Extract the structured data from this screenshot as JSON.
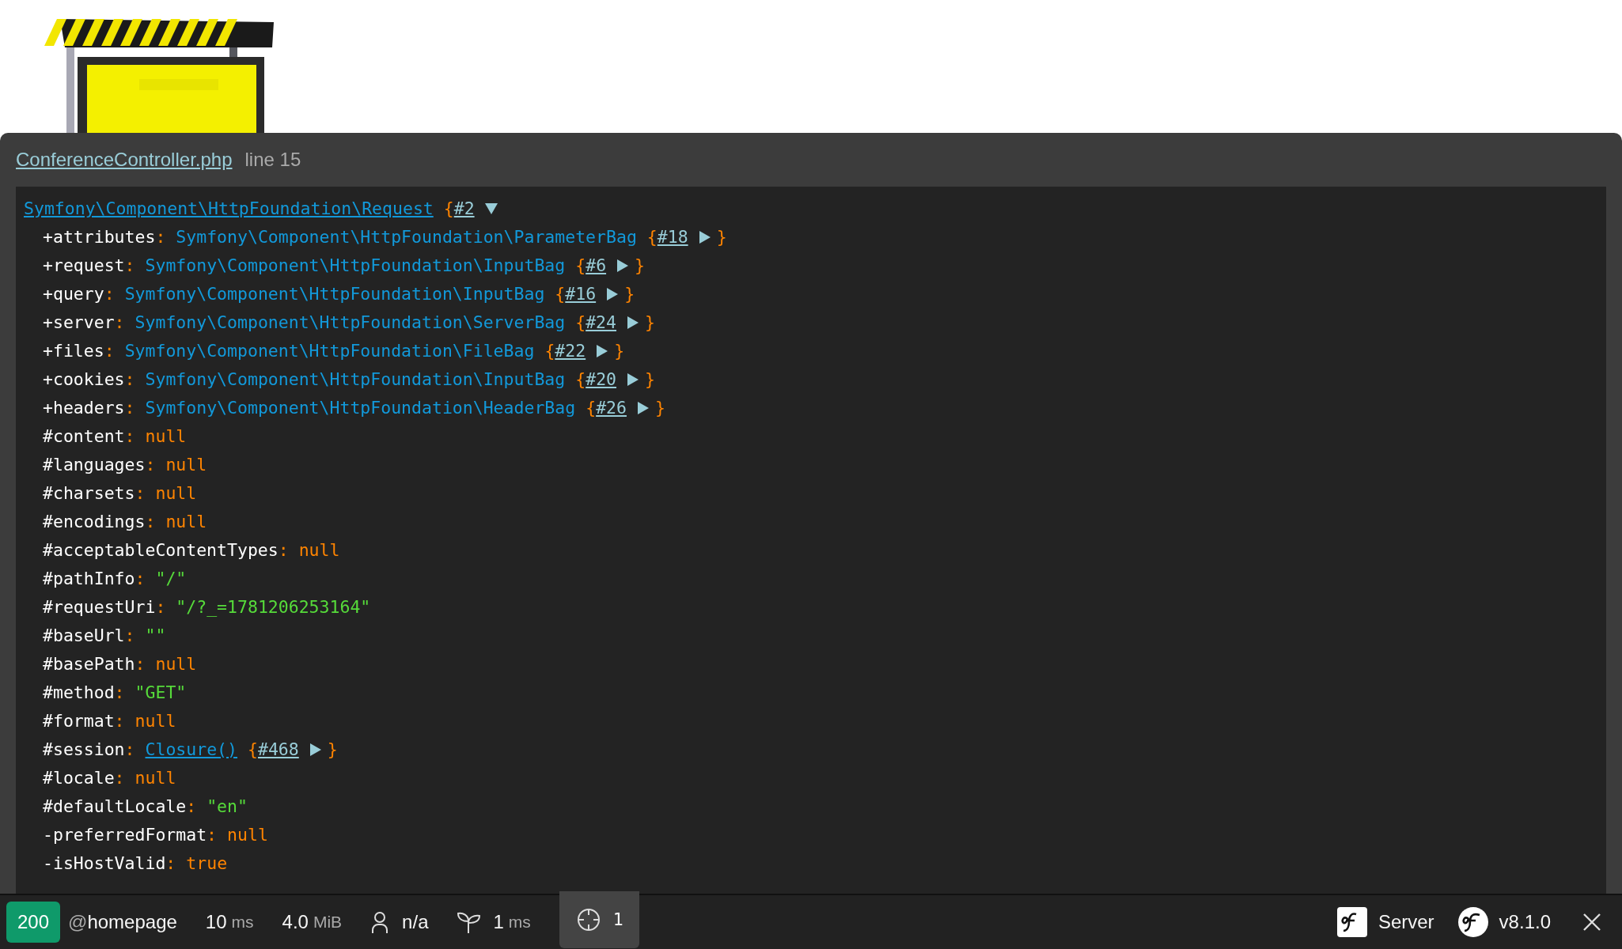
{
  "dump": {
    "file": "ConferenceController.php",
    "line": "line 15",
    "root": {
      "class": "Symfony\\Component\\HttpFoundation\\Request",
      "open": "{",
      "ref": "#2",
      "expanded": true
    },
    "rows": [
      {
        "prefix": "+",
        "key": "attributes",
        "sep": ":",
        "kind": "object",
        "value": "Symfony\\Component\\HttpFoundation\\ParameterBag",
        "open": "{",
        "ref": "#18",
        "expanded": false,
        "close": "}"
      },
      {
        "prefix": "+",
        "key": "request",
        "sep": ":",
        "kind": "object",
        "value": "Symfony\\Component\\HttpFoundation\\InputBag",
        "open": "{",
        "ref": "#6",
        "expanded": false,
        "close": "}"
      },
      {
        "prefix": "+",
        "key": "query",
        "sep": ":",
        "kind": "object",
        "value": "Symfony\\Component\\HttpFoundation\\InputBag",
        "open": "{",
        "ref": "#16",
        "expanded": false,
        "close": "}"
      },
      {
        "prefix": "+",
        "key": "server",
        "sep": ":",
        "kind": "object",
        "value": "Symfony\\Component\\HttpFoundation\\ServerBag",
        "open": "{",
        "ref": "#24",
        "expanded": false,
        "close": "}"
      },
      {
        "prefix": "+",
        "key": "files",
        "sep": ":",
        "kind": "object",
        "value": "Symfony\\Component\\HttpFoundation\\FileBag",
        "open": "{",
        "ref": "#22",
        "expanded": false,
        "close": "}"
      },
      {
        "prefix": "+",
        "key": "cookies",
        "sep": ":",
        "kind": "object",
        "value": "Symfony\\Component\\HttpFoundation\\InputBag",
        "open": "{",
        "ref": "#20",
        "expanded": false,
        "close": "}"
      },
      {
        "prefix": "+",
        "key": "headers",
        "sep": ":",
        "kind": "object",
        "value": "Symfony\\Component\\HttpFoundation\\HeaderBag",
        "open": "{",
        "ref": "#26",
        "expanded": false,
        "close": "}"
      },
      {
        "prefix": "#",
        "key": "content",
        "sep": ":",
        "kind": "const",
        "value": "null"
      },
      {
        "prefix": "#",
        "key": "languages",
        "sep": ":",
        "kind": "const",
        "value": "null"
      },
      {
        "prefix": "#",
        "key": "charsets",
        "sep": ":",
        "kind": "const",
        "value": "null"
      },
      {
        "prefix": "#",
        "key": "encodings",
        "sep": ":",
        "kind": "const",
        "value": "null"
      },
      {
        "prefix": "#",
        "key": "acceptableContentTypes",
        "sep": ":",
        "kind": "const",
        "value": "null"
      },
      {
        "prefix": "#",
        "key": "pathInfo",
        "sep": ":",
        "kind": "string",
        "value": "\"/\""
      },
      {
        "prefix": "#",
        "key": "requestUri",
        "sep": ":",
        "kind": "string",
        "value": "\"/?_=1781206253164\""
      },
      {
        "prefix": "#",
        "key": "baseUrl",
        "sep": ":",
        "kind": "string",
        "value": "\"\""
      },
      {
        "prefix": "#",
        "key": "basePath",
        "sep": ":",
        "kind": "const",
        "value": "null"
      },
      {
        "prefix": "#",
        "key": "method",
        "sep": ":",
        "kind": "string",
        "value": "\"GET\""
      },
      {
        "prefix": "#",
        "key": "format",
        "sep": ":",
        "kind": "const",
        "value": "null"
      },
      {
        "prefix": "#",
        "key": "session",
        "sep": ":",
        "kind": "object",
        "value": "Closure()",
        "linked": true,
        "open": "{",
        "ref": "#468",
        "expanded": false,
        "close": "}"
      },
      {
        "prefix": "#",
        "key": "locale",
        "sep": ":",
        "kind": "const",
        "value": "null"
      },
      {
        "prefix": "#",
        "key": "defaultLocale",
        "sep": ":",
        "kind": "string",
        "value": "\"en\""
      },
      {
        "prefix": "-",
        "key": "preferredFormat",
        "sep": ":",
        "kind": "const",
        "value": "null"
      },
      {
        "prefix": "-",
        "key": "isHostValid",
        "sep": ":",
        "kind": "const",
        "value": "true"
      }
    ]
  },
  "toolbar": {
    "status": "200",
    "route_prefix": "@",
    "route": "homepage",
    "items": [
      {
        "kind": "metric",
        "value": "10",
        "unit": "ms"
      },
      {
        "kind": "metric",
        "value": "4.0",
        "unit": "MiB"
      },
      {
        "kind": "user",
        "value": "n/a"
      },
      {
        "kind": "sprout",
        "value": "1",
        "unit": "ms"
      },
      {
        "kind": "dump",
        "value": "1",
        "selected": true
      }
    ],
    "right": [
      {
        "kind": "square",
        "label": "Server"
      },
      {
        "kind": "circle",
        "label": "v8.1.0"
      }
    ]
  }
}
